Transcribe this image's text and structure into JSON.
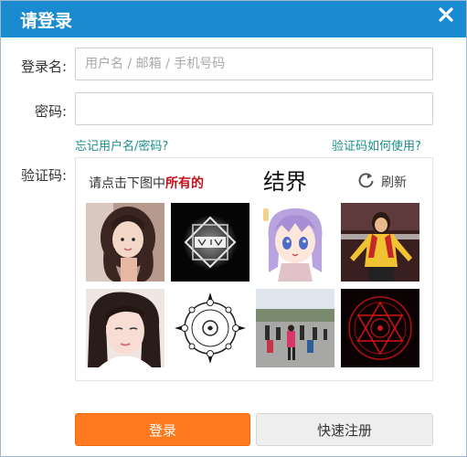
{
  "dialog": {
    "title": "请登录"
  },
  "form": {
    "username_label": "登录名:",
    "username_placeholder": "用户名 / 邮箱 / 手机号码",
    "password_label": "密码:",
    "forgot_link": "忘记用户名/密码?",
    "captcha_help_link": "验证码如何使用?",
    "captcha_label": "验证码:"
  },
  "captcha": {
    "prompt_prefix": "请点击下图中",
    "prompt_highlight": "所有的",
    "target_word": "结界",
    "refresh_label": "刷新",
    "tiles": [
      {
        "subject": "girl-portrait"
      },
      {
        "subject": "glowing-emblem"
      },
      {
        "subject": "anime-girl"
      },
      {
        "subject": "woman-dancing"
      },
      {
        "subject": "girl-closeup"
      },
      {
        "subject": "magic-circle-white"
      },
      {
        "subject": "crowd-square-dancing"
      },
      {
        "subject": "magic-circle-red"
      }
    ]
  },
  "buttons": {
    "login_label": "登录",
    "register_label": "快速注册"
  },
  "colors": {
    "titlebar": "#1a8bd0",
    "link": "#1b8f8a",
    "login_button": "#ff7a1e",
    "highlight_red": "#c0131b"
  }
}
